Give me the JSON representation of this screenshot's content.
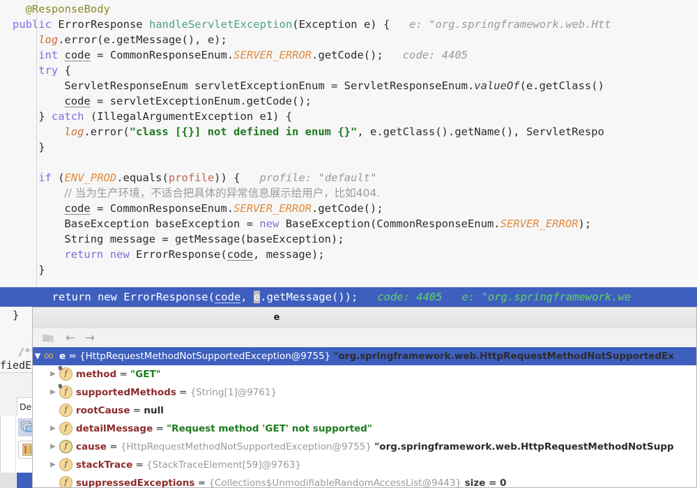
{
  "editor": {
    "language": "java",
    "indent_guide": true,
    "lines": [
      {
        "indent": 1,
        "segments": [
          {
            "t": "@ResponseBody",
            "c": "anno"
          }
        ]
      },
      {
        "indent": 0,
        "segments": [
          {
            "t": "public ",
            "c": "kw"
          },
          {
            "t": "ErrorResponse ",
            "c": "plain"
          },
          {
            "t": "handleServletException",
            "c": "mth"
          },
          {
            "t": "(Exception e) {",
            "c": "plain"
          },
          {
            "t": "   e: \"org.springframework.web.Htt",
            "c": "hint"
          }
        ]
      },
      {
        "indent": 2,
        "segments": [
          {
            "t": "log",
            "c": "fieldref"
          },
          {
            "t": ".error(e.getMessage(), e);",
            "c": "plain"
          }
        ]
      },
      {
        "indent": 2,
        "segments": [
          {
            "t": "int ",
            "c": "kw"
          },
          {
            "t": "code",
            "c": "und"
          },
          {
            "t": " = CommonResponseEnum.",
            "c": "plain"
          },
          {
            "t": "SERVER_ERROR",
            "c": "statfield"
          },
          {
            "t": ".getCode();",
            "c": "plain"
          },
          {
            "t": "   code: 4405",
            "c": "hint"
          }
        ]
      },
      {
        "indent": 2,
        "segments": [
          {
            "t": "try ",
            "c": "kw"
          },
          {
            "t": "{",
            "c": "plain"
          }
        ]
      },
      {
        "indent": 4,
        "segments": [
          {
            "t": "ServletResponseEnum servletExceptionEnum = ServletResponseEnum.",
            "c": "plain"
          },
          {
            "t": "valueOf",
            "c": "staticmth"
          },
          {
            "t": "(e.getClass()",
            "c": "plain"
          }
        ]
      },
      {
        "indent": 4,
        "segments": [
          {
            "t": "code",
            "c": "und"
          },
          {
            "t": " = servletExceptionEnum.getCode();",
            "c": "plain"
          }
        ]
      },
      {
        "indent": 2,
        "segments": [
          {
            "t": "} ",
            "c": "plain"
          },
          {
            "t": "catch ",
            "c": "kw"
          },
          {
            "t": "(IllegalArgumentException e1) {",
            "c": "plain"
          }
        ]
      },
      {
        "indent": 4,
        "segments": [
          {
            "t": "log",
            "c": "fieldref"
          },
          {
            "t": ".error(",
            "c": "plain"
          },
          {
            "t": "\"class [{}] not defined in enum {}\"",
            "c": "str"
          },
          {
            "t": ", e.getClass().getName(), ServletRespo",
            "c": "plain"
          }
        ]
      },
      {
        "indent": 2,
        "segments": [
          {
            "t": "}",
            "c": "plain"
          }
        ]
      },
      {
        "indent": 0,
        "segments": []
      },
      {
        "indent": 2,
        "segments": [
          {
            "t": "if ",
            "c": "kw"
          },
          {
            "t": "(",
            "c": "plain"
          },
          {
            "t": "ENV_PROD",
            "c": "statfield"
          },
          {
            "t": ".equals(",
            "c": "plain"
          },
          {
            "t": "profile",
            "c": "param"
          },
          {
            "t": ")) {",
            "c": "plain"
          },
          {
            "t": "   profile: \"default\"",
            "c": "hint"
          }
        ]
      },
      {
        "indent": 4,
        "segments": [
          {
            "t": "// 当为生产环境，不适合把具体的异常信息展示给用户，比如404.",
            "c": "cmt"
          }
        ]
      },
      {
        "indent": 4,
        "segments": [
          {
            "t": "code",
            "c": "und"
          },
          {
            "t": " = CommonResponseEnum.",
            "c": "plain"
          },
          {
            "t": "SERVER_ERROR",
            "c": "statfield"
          },
          {
            "t": ".getCode();",
            "c": "plain"
          }
        ]
      },
      {
        "indent": 4,
        "segments": [
          {
            "t": "BaseException baseException = ",
            "c": "plain"
          },
          {
            "t": "new ",
            "c": "kw"
          },
          {
            "t": "BaseException(CommonResponseEnum.",
            "c": "plain"
          },
          {
            "t": "SERVER_ERROR",
            "c": "statfield"
          },
          {
            "t": ");",
            "c": "plain"
          }
        ]
      },
      {
        "indent": 4,
        "segments": [
          {
            "t": "String message = getMessage(baseException);",
            "c": "plain"
          }
        ]
      },
      {
        "indent": 4,
        "segments": [
          {
            "t": "return new ",
            "c": "kw"
          },
          {
            "t": "ErrorResponse(",
            "c": "plain"
          },
          {
            "t": "code",
            "c": "und"
          },
          {
            "t": ", message);",
            "c": "plain"
          }
        ]
      },
      {
        "indent": 2,
        "segments": [
          {
            "t": "}",
            "c": "plain"
          }
        ]
      }
    ],
    "exec_line": {
      "prefix": "        return new ErrorResponse(",
      "code_token": "code",
      "mid": ", ",
      "selected_char": "e",
      "suffix": ".getMessage());",
      "hints": "   code: 4405   e: \"org.springframework.we",
      "highlight_color": "#3f5fbf",
      "hint_color": "#62d362"
    },
    "closing_brace": "}",
    "hidden_fragment_javadoc": "/**",
    "hidden_fragment_code": "fiedExce"
  },
  "tool_window": {
    "tab_label": "De",
    "buttons": [
      {
        "name": "frames-button",
        "state": "selected"
      },
      {
        "name": "variables-button",
        "state": "hover"
      }
    ]
  },
  "popup": {
    "title": "e",
    "toolbar": [
      {
        "name": "show-frames-icon",
        "label": ""
      },
      {
        "name": "back-arrow-icon",
        "label": "←"
      },
      {
        "name": "forward-arrow-icon",
        "label": "→"
      }
    ],
    "tree": [
      {
        "indent": 0,
        "twisty": "expanded",
        "icon": "watch-glasses-icon",
        "selected": true,
        "name": "e",
        "eq": " = ",
        "value": "{HttpRequestMethodNotSupportedException@9755} ",
        "quoted": "\"org.springframework.web.HttpRequestMethodNotSupportedEx",
        "value_kind": "object"
      },
      {
        "indent": 1,
        "twisty": "collapsed",
        "icon": "field-final-icon",
        "selected": false,
        "name": "method",
        "eq": " = ",
        "value": "\"GET\"",
        "value_kind": "string"
      },
      {
        "indent": 1,
        "twisty": "collapsed",
        "icon": "field-final-icon",
        "selected": false,
        "name": "supportedMethods",
        "eq": " = ",
        "value": "{String[1]@9761}",
        "value_kind": "object"
      },
      {
        "indent": 1,
        "twisty": "none",
        "icon": "field-icon",
        "selected": false,
        "name": "rootCause",
        "eq": " = ",
        "value": "null",
        "value_kind": "null"
      },
      {
        "indent": 1,
        "twisty": "collapsed",
        "icon": "field-icon",
        "selected": false,
        "name": "detailMessage",
        "eq": " = ",
        "value": "\"Request method 'GET' not supported\"",
        "value_kind": "string"
      },
      {
        "indent": 1,
        "twisty": "collapsed",
        "icon": "field-circled-icon",
        "selected": false,
        "name": "cause",
        "eq": " = ",
        "value": "{HttpRequestMethodNotSupportedException@9755} ",
        "quoted": "\"org.springframework.web.HttpRequestMethodNotSupp",
        "value_kind": "object"
      },
      {
        "indent": 1,
        "twisty": "collapsed",
        "icon": "field-icon",
        "selected": false,
        "name": "stackTrace",
        "eq": " = ",
        "value": "{StackTraceElement[59]@9763}",
        "value_kind": "object"
      },
      {
        "indent": 1,
        "twisty": "none",
        "icon": "field-icon",
        "selected": false,
        "name": "suppressedExceptions",
        "eq": " = ",
        "value": "{Collections$UnmodifiableRandomAccessList@9443}",
        "extra": "  size = 0",
        "value_kind": "object"
      }
    ]
  },
  "colors": {
    "selection_blue": "#3f5fbf",
    "string_green": "#1f7a1f",
    "inline_hint_green": "#62d362",
    "field_name_red": "#8d2b2b",
    "editor_bg": "#f7f7f7",
    "panel_bg": "#f2f2f2",
    "static_field_orange": "#e08a3c"
  }
}
